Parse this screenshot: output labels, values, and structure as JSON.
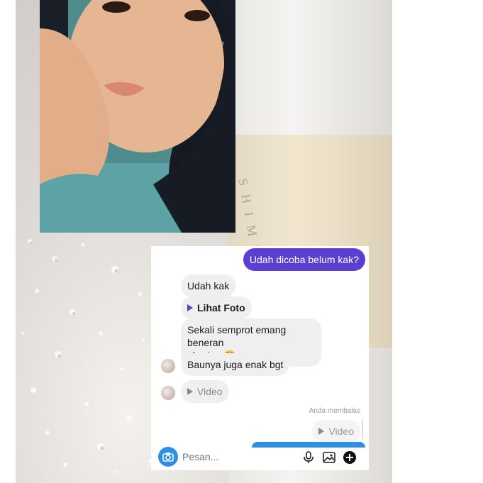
{
  "chat": {
    "messages": [
      {
        "from": "me",
        "text": "Udah dicoba belum kak?"
      },
      {
        "from": "them",
        "text": "Udah kak"
      },
      {
        "from": "them",
        "text": "Lihat Foto"
      },
      {
        "from": "them",
        "text": "Sekali semprot emang beneran"
      },
      {
        "from": "them",
        "text": "glowing 😍"
      },
      {
        "from": "them",
        "text": "Baunya juga enak bgt"
      },
      {
        "from": "them",
        "text": "Video"
      },
      {
        "from": "me",
        "text": "Video"
      }
    ],
    "reply_note": "Anda membalas"
  },
  "composer": {
    "placeholder": "Pesan...",
    "camera_icon": "camera-icon",
    "mic_icon": "microphone-icon",
    "gallery_icon": "gallery-icon",
    "add_icon": "add-icon"
  },
  "colors": {
    "outgoing_bubble": "#5b3fd0",
    "incoming_bubble": "#efefef",
    "camera_button": "#2f8fe6"
  }
}
